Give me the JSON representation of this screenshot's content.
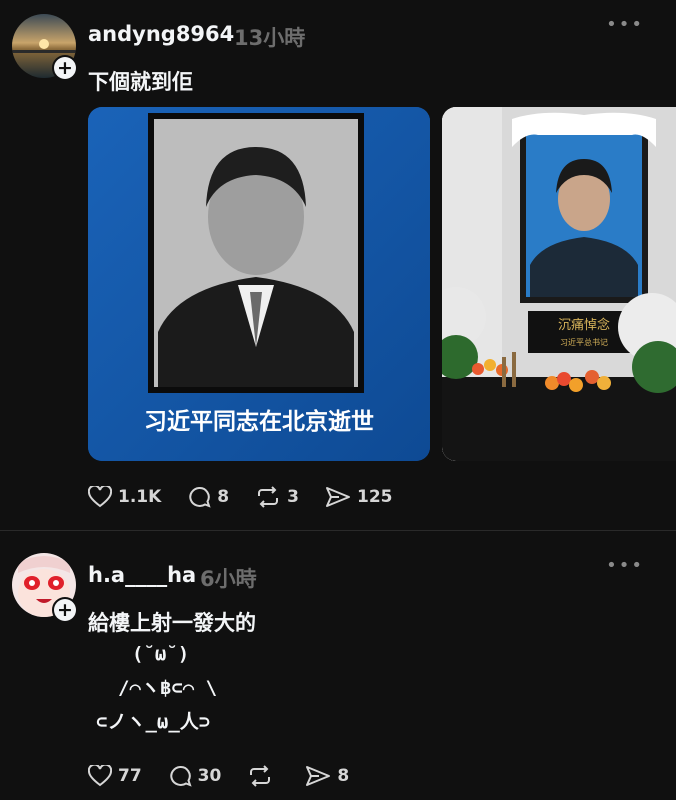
{
  "posts": [
    {
      "username": "andyng8964",
      "time": "13小時",
      "text": "下個就到佢",
      "media": [
        {
          "caption": "习近平同志在北京逝世",
          "description": "black-and-white portrait on blue background"
        },
        {
          "plaque_text": "沉痛悼念",
          "plaque_sub": "习近平总书记",
          "description": "memorial altar with portrait, flowers and fruit"
        }
      ],
      "likes": "1.1K",
      "comments": "8",
      "reposts": "3",
      "shares": "125"
    },
    {
      "username": "h.a____ha",
      "time": "6小時",
      "text": "給樓上射一發大的",
      "ascii_art": [
        "(˘ω˘)",
        "/⌒ヽ฿⊂⌒ \\",
        "⊂ノヽ_ω_人⊃"
      ],
      "likes": "77",
      "comments": "30",
      "reposts": "",
      "shares": "8"
    }
  ],
  "icons": {
    "like": "heart-icon",
    "comment": "comment-bubble-icon",
    "repost": "repost-icon",
    "share": "send-icon",
    "more": "more-horizontal-icon",
    "follow": "plus-icon"
  },
  "colors": {
    "background": "#101010",
    "text": "#f3f5f7",
    "muted": "#6d6d6d",
    "media_blue": "#1256a8"
  }
}
